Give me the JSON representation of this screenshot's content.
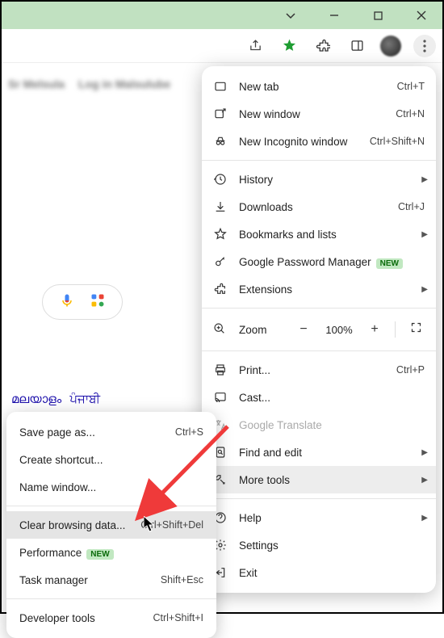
{
  "window": {
    "minimize": "−",
    "maximize": "☐",
    "close": "✕",
    "dropdown": "⌄"
  },
  "toolbar": {
    "share": "share",
    "bookmark_star": "★",
    "extensions": "puzzle",
    "sidepanel": "panel",
    "profile": "avatar",
    "menu": "kebab"
  },
  "page": {
    "blur1": "Sr Melsula",
    "blur2": "Log in  Malsulube",
    "lang1": "മലയാളം",
    "lang2": "ਪੰਜਾਬੀ"
  },
  "menu": {
    "new_tab": "New tab",
    "new_tab_sc": "Ctrl+T",
    "new_window": "New window",
    "new_window_sc": "Ctrl+N",
    "incognito": "New Incognito window",
    "incognito_sc": "Ctrl+Shift+N",
    "history": "History",
    "downloads": "Downloads",
    "downloads_sc": "Ctrl+J",
    "bookmarks": "Bookmarks and lists",
    "password_mgr": "Google Password Manager",
    "new_badge": "NEW",
    "extensions": "Extensions",
    "zoom_label": "Zoom",
    "zoom_out": "−",
    "zoom_val": "100%",
    "zoom_in": "+",
    "print": "Print...",
    "print_sc": "Ctrl+P",
    "cast": "Cast...",
    "translate": "Google Translate",
    "find": "Find and edit",
    "more_tools": "More tools",
    "help": "Help",
    "settings": "Settings",
    "exit": "Exit"
  },
  "submenu": {
    "save_page": "Save page as...",
    "save_page_sc": "Ctrl+S",
    "create_shortcut": "Create shortcut...",
    "name_window": "Name window...",
    "clear_data": "Clear browsing data...",
    "clear_data_sc": "Ctrl+Shift+Del",
    "performance": "Performance",
    "task_manager": "Task manager",
    "task_manager_sc": "Shift+Esc",
    "dev_tools": "Developer tools",
    "dev_tools_sc": "Ctrl+Shift+I"
  }
}
